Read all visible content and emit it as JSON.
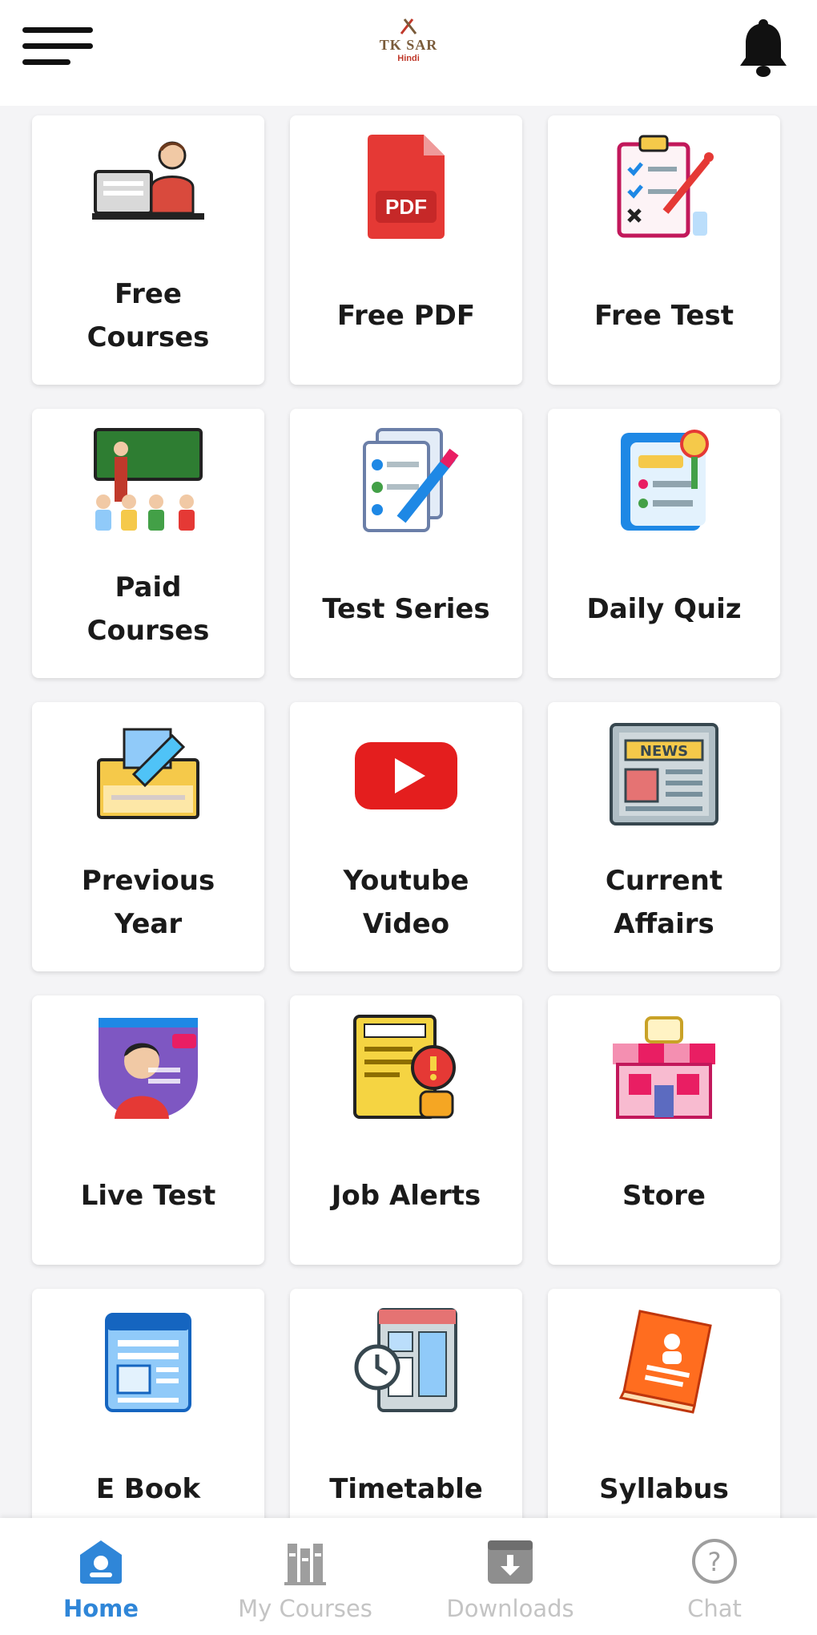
{
  "header": {
    "logo_text": "TK SAR",
    "logo_sub": "Hindi",
    "logo_icon": "crossed-pens-logo",
    "menu_icon": "hamburger-menu-icon",
    "bell_icon": "bell-icon"
  },
  "tiles": [
    {
      "label": "Free\nCourses",
      "icon": "teacher-computer-icon"
    },
    {
      "label": "Free PDF",
      "icon": "pdf-file-icon"
    },
    {
      "label": "Free Test",
      "icon": "checklist-clipboard-icon"
    },
    {
      "label": "Paid\nCourses",
      "icon": "classroom-icon"
    },
    {
      "label": "Test Series",
      "icon": "test-paper-pencil-icon"
    },
    {
      "label": "Daily Quiz",
      "icon": "quiz-document-icon"
    },
    {
      "label": "Previous\nYear",
      "icon": "archive-box-icon"
    },
    {
      "label": "Youtube\nVideo",
      "icon": "youtube-play-icon"
    },
    {
      "label": "Current\nAffairs",
      "icon": "newspaper-icon"
    },
    {
      "label": "Live Test",
      "icon": "live-person-icon"
    },
    {
      "label": "Job Alerts",
      "icon": "job-alert-icon"
    },
    {
      "label": "Store",
      "icon": "storefront-icon"
    },
    {
      "label": "E Book",
      "icon": "ebook-icon"
    },
    {
      "label": "Timetable",
      "icon": "timetable-clock-icon"
    },
    {
      "label": "Syllabus",
      "icon": "syllabus-book-icon"
    }
  ],
  "bottom_nav": [
    {
      "label": "Home",
      "icon": "home-icon",
      "active": true
    },
    {
      "label": "My Courses",
      "icon": "books-icon",
      "active": false
    },
    {
      "label": "Downloads",
      "icon": "download-icon",
      "active": false
    },
    {
      "label": "Chat",
      "icon": "help-chat-icon",
      "active": false
    }
  ],
  "colors": {
    "accent": "#2f86d8",
    "inactive": "#c4c4c4",
    "tile_bg": "#ffffff",
    "page_bg": "#f4f4f6"
  }
}
